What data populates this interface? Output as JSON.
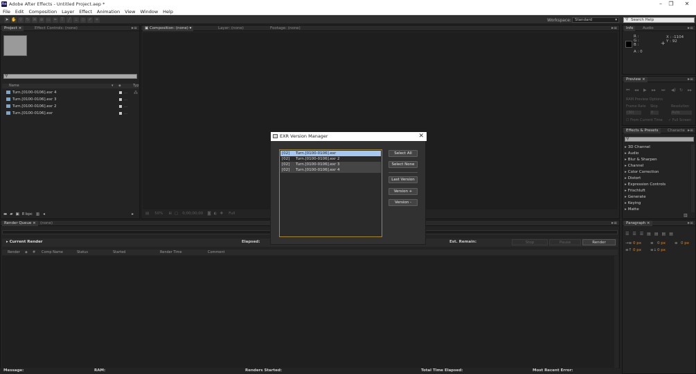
{
  "window": {
    "title": "Adobe After Effects - Untitled Project.aep *",
    "app_icon": "Ae"
  },
  "menubar": [
    "File",
    "Edit",
    "Composition",
    "Layer",
    "Effect",
    "Animation",
    "View",
    "Window",
    "Help"
  ],
  "toolbar": {
    "workspace_label": "Workspace:",
    "workspace_value": "Standard",
    "search_placeholder": "Search Help"
  },
  "project": {
    "tabs": [
      "Project ×",
      "Effect Controls: (none)"
    ],
    "columns": [
      "Name",
      "Typ"
    ],
    "items": [
      "Turn.[0100-0106].exr 4",
      "Turn.[0100-0106].exr 3",
      "Turn.[0100-0106].exr 2",
      "Turn.[0100-0106].exr"
    ],
    "bpc": "8 bpc"
  },
  "composition": {
    "tabs": [
      "Composition: (none)",
      "Layer: (none)",
      "Footage: (none)"
    ],
    "footer": {
      "zoom": "50%",
      "timecode": "0;00;00;00",
      "resolution": "Full"
    }
  },
  "info": {
    "tabs": [
      "Info",
      "Audio"
    ],
    "channels": [
      "R :",
      "G :",
      "B :",
      "A : 0"
    ],
    "x": "X : -1104",
    "y": "Y : 92"
  },
  "preview": {
    "tab": "Preview",
    "ram_options": "RAM Preview Options",
    "frame_rate_label": "Frame Rate",
    "skip_label": "Skip",
    "resolution_label": "Resolution",
    "frame_rate_value": "(30)",
    "skip_value": "0",
    "resolution_value": "Auto",
    "from_current": "From Current Time",
    "full_screen": "Full Screen"
  },
  "effects": {
    "tabs": [
      "Effects & Presets",
      "Characte"
    ],
    "items": [
      "3D Channel",
      "Audio",
      "Blur & Sharpen",
      "Channel",
      "Color Correction",
      "Distort",
      "Expression Controls",
      "Frischluft",
      "Generate",
      "Keying",
      "Matte"
    ]
  },
  "paragraph": {
    "tab": "Paragraph",
    "indent1": "0 px",
    "indent2": "0 px",
    "indent3": "0 px",
    "space1": "0 px",
    "space2": "0 px"
  },
  "render_queue": {
    "tabs": [
      "Render Queue ×",
      "(none)"
    ],
    "current_render": "Current Render",
    "elapsed": "Elapsed:",
    "est_remain": "Est. Remain:",
    "buttons": {
      "stop": "Stop",
      "pause": "Pause",
      "render": "Render"
    },
    "columns": [
      "Render",
      "#",
      "Comp Name",
      "Status",
      "Started",
      "Render Time",
      "Comment"
    ]
  },
  "status": {
    "message": "Message:",
    "ram": "RAM:",
    "renders_started": "Renders Started:",
    "total_time": "Total Time Elapsed:",
    "recent_error": "Most Recent Error:"
  },
  "dialog": {
    "title": "EXR Version Manager",
    "items": [
      "[02]     Turn.[0100-0106].exr",
      "[02]     Turn.[0100-0106].exr 2",
      "[02]     Turn.[0100-0106].exr 3",
      "[02]     Turn.[0100-0106].exr 4"
    ],
    "buttons": {
      "select_all": "Select All",
      "select_none": "Select None",
      "last_version": "Last Version",
      "version_plus": "Version +",
      "version_minus": "Version -"
    }
  }
}
